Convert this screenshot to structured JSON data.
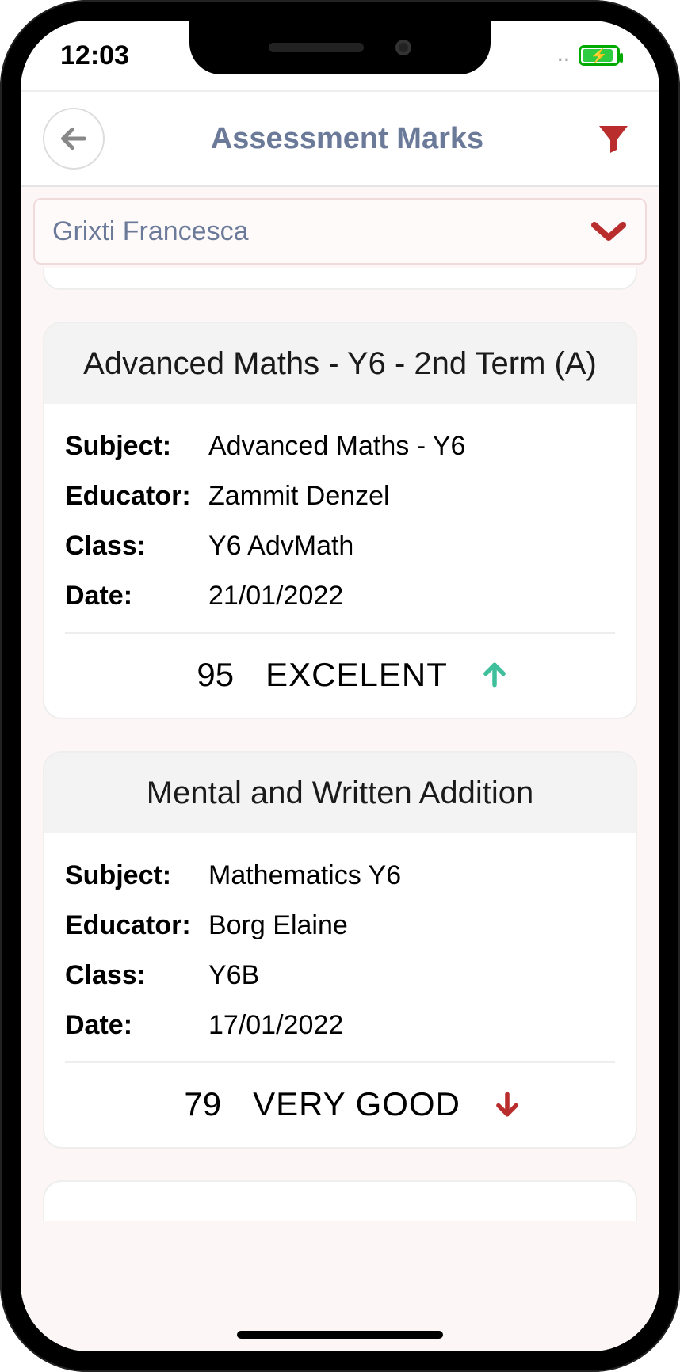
{
  "status": {
    "time": "12:03",
    "dots": ".."
  },
  "header": {
    "title": "Assessment Marks"
  },
  "student": {
    "selected": "Grixti Francesca"
  },
  "labels": {
    "subject": "Subject:",
    "educator": "Educator:",
    "class": "Class:",
    "date": "Date:"
  },
  "cards": [
    {
      "title": "Advanced Maths - Y6 - 2nd Term (A)",
      "subject": "Advanced Maths - Y6",
      "educator": "Zammit Denzel",
      "class": "Y6 AdvMath",
      "date": "21/01/2022",
      "score": "95",
      "grade": "EXCELENT",
      "trend": "up"
    },
    {
      "title": "Mental and Written Addition",
      "subject": "Mathematics  Y6",
      "educator": "Borg Elaine",
      "class": "Y6B",
      "date": "17/01/2022",
      "score": "79",
      "grade": "VERY GOOD",
      "trend": "down"
    }
  ]
}
